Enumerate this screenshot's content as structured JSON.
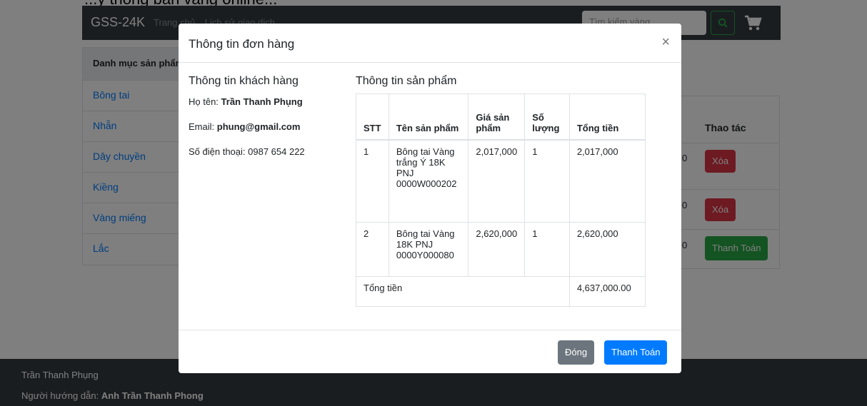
{
  "top_text": "...y thống bán vàng online...",
  "navbar": {
    "brand": "GSS-24K",
    "links": [
      "Trang chủ",
      "Lịch sử giao dịch"
    ],
    "search_placeholder": "Tìm kiếm vàng",
    "search_icon": "search-icon",
    "cart_icon": "cart-icon"
  },
  "sidebar": {
    "title": "Danh mục sản phẩm",
    "items": [
      "Bông tai",
      "Nhẫn",
      "Dây chuyền",
      "Kiềng",
      "Vàng miếng",
      "Lắc"
    ]
  },
  "bg_table": {
    "header": "Thao tác",
    "row_suffix": "0",
    "delete_label": "Xóa",
    "pay_label": "Thanh Toán"
  },
  "footer": {
    "author": "Trần Thanh Phụng",
    "advisor_label": "Người hướng dẫn:",
    "advisor_name": "Anh Trần Thanh Phong"
  },
  "modal": {
    "title": "Thông tin đơn hàng",
    "close_symbol": "×",
    "customer": {
      "heading": "Thông tin khách hàng",
      "name_label": "Họ tên:",
      "name": "Trần Thanh Phụng",
      "email_label": "Email:",
      "email": "phung@gmail.com",
      "phone_label": "Số điện thoại:",
      "phone": "0987 654 222"
    },
    "products": {
      "heading": "Thông tin sản phẩm",
      "columns": [
        "STT",
        "Tên sản phẩm",
        "Giá sản phẩm",
        "Số lượng",
        "Tổng tiền"
      ],
      "rows": [
        {
          "stt": "1",
          "name": "Bông tai Vàng trắng Ý 18K PNJ 0000W000202",
          "price": "2,017,000",
          "qty": "1",
          "total": "2,017,000"
        },
        {
          "stt": "2",
          "name": "Bông tai Vàng 18K PNJ 0000Y000080",
          "price": "2,620,000",
          "qty": "1",
          "total": "2,620,000"
        }
      ],
      "total_label": "Tổng tiền",
      "total_value": "4,637,000.00"
    },
    "close_button": "Đóng",
    "pay_button": "Thanh Toán"
  }
}
